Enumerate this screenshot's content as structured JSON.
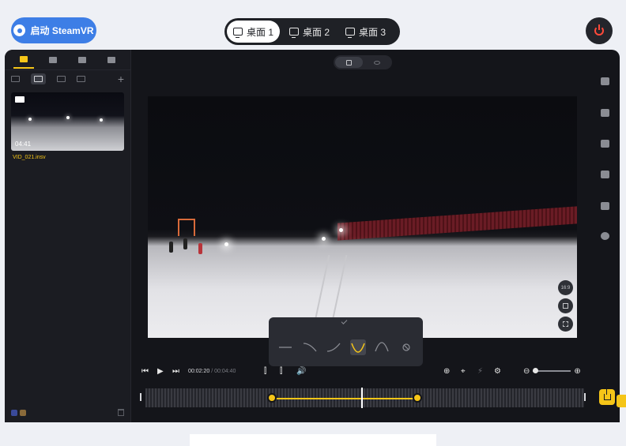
{
  "topbar": {
    "steam_label": "启动 SteamVR",
    "desktops": [
      {
        "label": "桌面 1",
        "active": true
      },
      {
        "label": "桌面 2",
        "active": false
      },
      {
        "label": "桌面 3",
        "active": false
      }
    ]
  },
  "library": {
    "clip": {
      "duration": "04:41",
      "filename": "VID_021.insv"
    }
  },
  "preview": {
    "aspect_label": "16:9"
  },
  "playback": {
    "current_time": "00:02:20",
    "total_time": "/ 00:04:40"
  },
  "colors": {
    "accent": "#f5c518",
    "steam_blue": "#3d7ee6",
    "power_red": "#ff4a3a",
    "panel_bg": "#14151a"
  }
}
